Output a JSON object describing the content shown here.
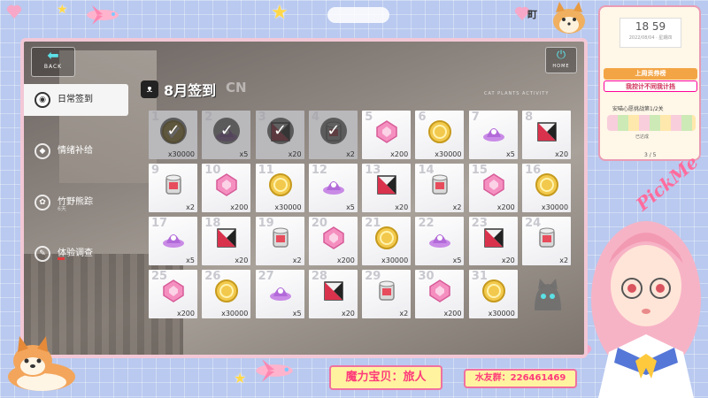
{
  "game": {
    "back_label": "BACK",
    "home_label": "HOME",
    "title": "8月签到",
    "title_en": "CN",
    "subtitle": "CAT PLANTS ACTIVITY",
    "menu": [
      {
        "label": "日常签到",
        "sub": ""
      },
      {
        "label": "情绪补给",
        "sub": ""
      },
      {
        "label": "竹野熊踪",
        "sub": "6天"
      },
      {
        "label": "体验调查",
        "sub": ""
      }
    ],
    "rewards": [
      {
        "day": "1",
        "item": "gold-check",
        "qty": "x30000",
        "claimed": true
      },
      {
        "day": "2",
        "item": "purple-hat",
        "qty": "x5",
        "claimed": true
      },
      {
        "day": "3",
        "item": "red-cube",
        "qty": "x20",
        "claimed": true
      },
      {
        "day": "4",
        "item": "can",
        "qty": "x2",
        "claimed": true
      },
      {
        "day": "5",
        "item": "pink-crystal",
        "qty": "x200",
        "claimed": false
      },
      {
        "day": "6",
        "item": "gold-coin",
        "qty": "x30000",
        "claimed": false
      },
      {
        "day": "7",
        "item": "purple-hat",
        "qty": "x5",
        "claimed": false
      },
      {
        "day": "8",
        "item": "red-cube",
        "qty": "x20",
        "claimed": false
      },
      {
        "day": "9",
        "item": "can",
        "qty": "x2",
        "claimed": false
      },
      {
        "day": "10",
        "item": "pink-crystal",
        "qty": "x200",
        "claimed": false
      },
      {
        "day": "11",
        "item": "gold-coin",
        "qty": "x30000",
        "claimed": false
      },
      {
        "day": "12",
        "item": "purple-hat",
        "qty": "x5",
        "claimed": false
      },
      {
        "day": "13",
        "item": "red-cube",
        "qty": "x20",
        "claimed": false
      },
      {
        "day": "14",
        "item": "can",
        "qty": "x2",
        "claimed": false
      },
      {
        "day": "15",
        "item": "pink-crystal",
        "qty": "x200",
        "claimed": false
      },
      {
        "day": "16",
        "item": "gold-coin",
        "qty": "x30000",
        "claimed": false
      },
      {
        "day": "17",
        "item": "purple-hat",
        "qty": "x5",
        "claimed": false
      },
      {
        "day": "18",
        "item": "red-cube",
        "qty": "x20",
        "claimed": false
      },
      {
        "day": "19",
        "item": "can",
        "qty": "x2",
        "claimed": false
      },
      {
        "day": "20",
        "item": "pink-crystal",
        "qty": "x200",
        "claimed": false
      },
      {
        "day": "21",
        "item": "gold-coin",
        "qty": "x30000",
        "claimed": false
      },
      {
        "day": "22",
        "item": "purple-hat",
        "qty": "x5",
        "claimed": false
      },
      {
        "day": "23",
        "item": "red-cube",
        "qty": "x20",
        "claimed": false
      },
      {
        "day": "24",
        "item": "can",
        "qty": "x2",
        "claimed": false
      },
      {
        "day": "25",
        "item": "pink-crystal",
        "qty": "x200",
        "claimed": false
      },
      {
        "day": "26",
        "item": "gold-coin",
        "qty": "x30000",
        "claimed": false
      },
      {
        "day": "27",
        "item": "purple-hat",
        "qty": "x5",
        "claimed": false
      },
      {
        "day": "28",
        "item": "red-cube",
        "qty": "x20",
        "claimed": false
      },
      {
        "day": "29",
        "item": "can",
        "qty": "x2",
        "claimed": false
      },
      {
        "day": "30",
        "item": "pink-crystal",
        "qty": "x200",
        "claimed": false
      },
      {
        "day": "31",
        "item": "gold-coin",
        "qty": "x30000",
        "claimed": false
      }
    ]
  },
  "overlay": {
    "clock_time": "18  59",
    "clock_date": "2022/08/04 · 星期四",
    "tag1": "上周贡券榜",
    "tag2": "我控计不同我计挡",
    "quest": "安喵心愿挑战第1/2关",
    "quest_status": "已达成",
    "page": "3 / 5",
    "pickme": "PickMe",
    "banner1": "魔力宝贝：旅人",
    "banner2": "水友群：226461469",
    "corner_letter": "町"
  },
  "colors": {
    "pink_border": "#f071a1",
    "accent_cyan": "#5ce0e6",
    "banner_text": "#ff3b7a",
    "overlay_bg": "#b9c9ef"
  }
}
